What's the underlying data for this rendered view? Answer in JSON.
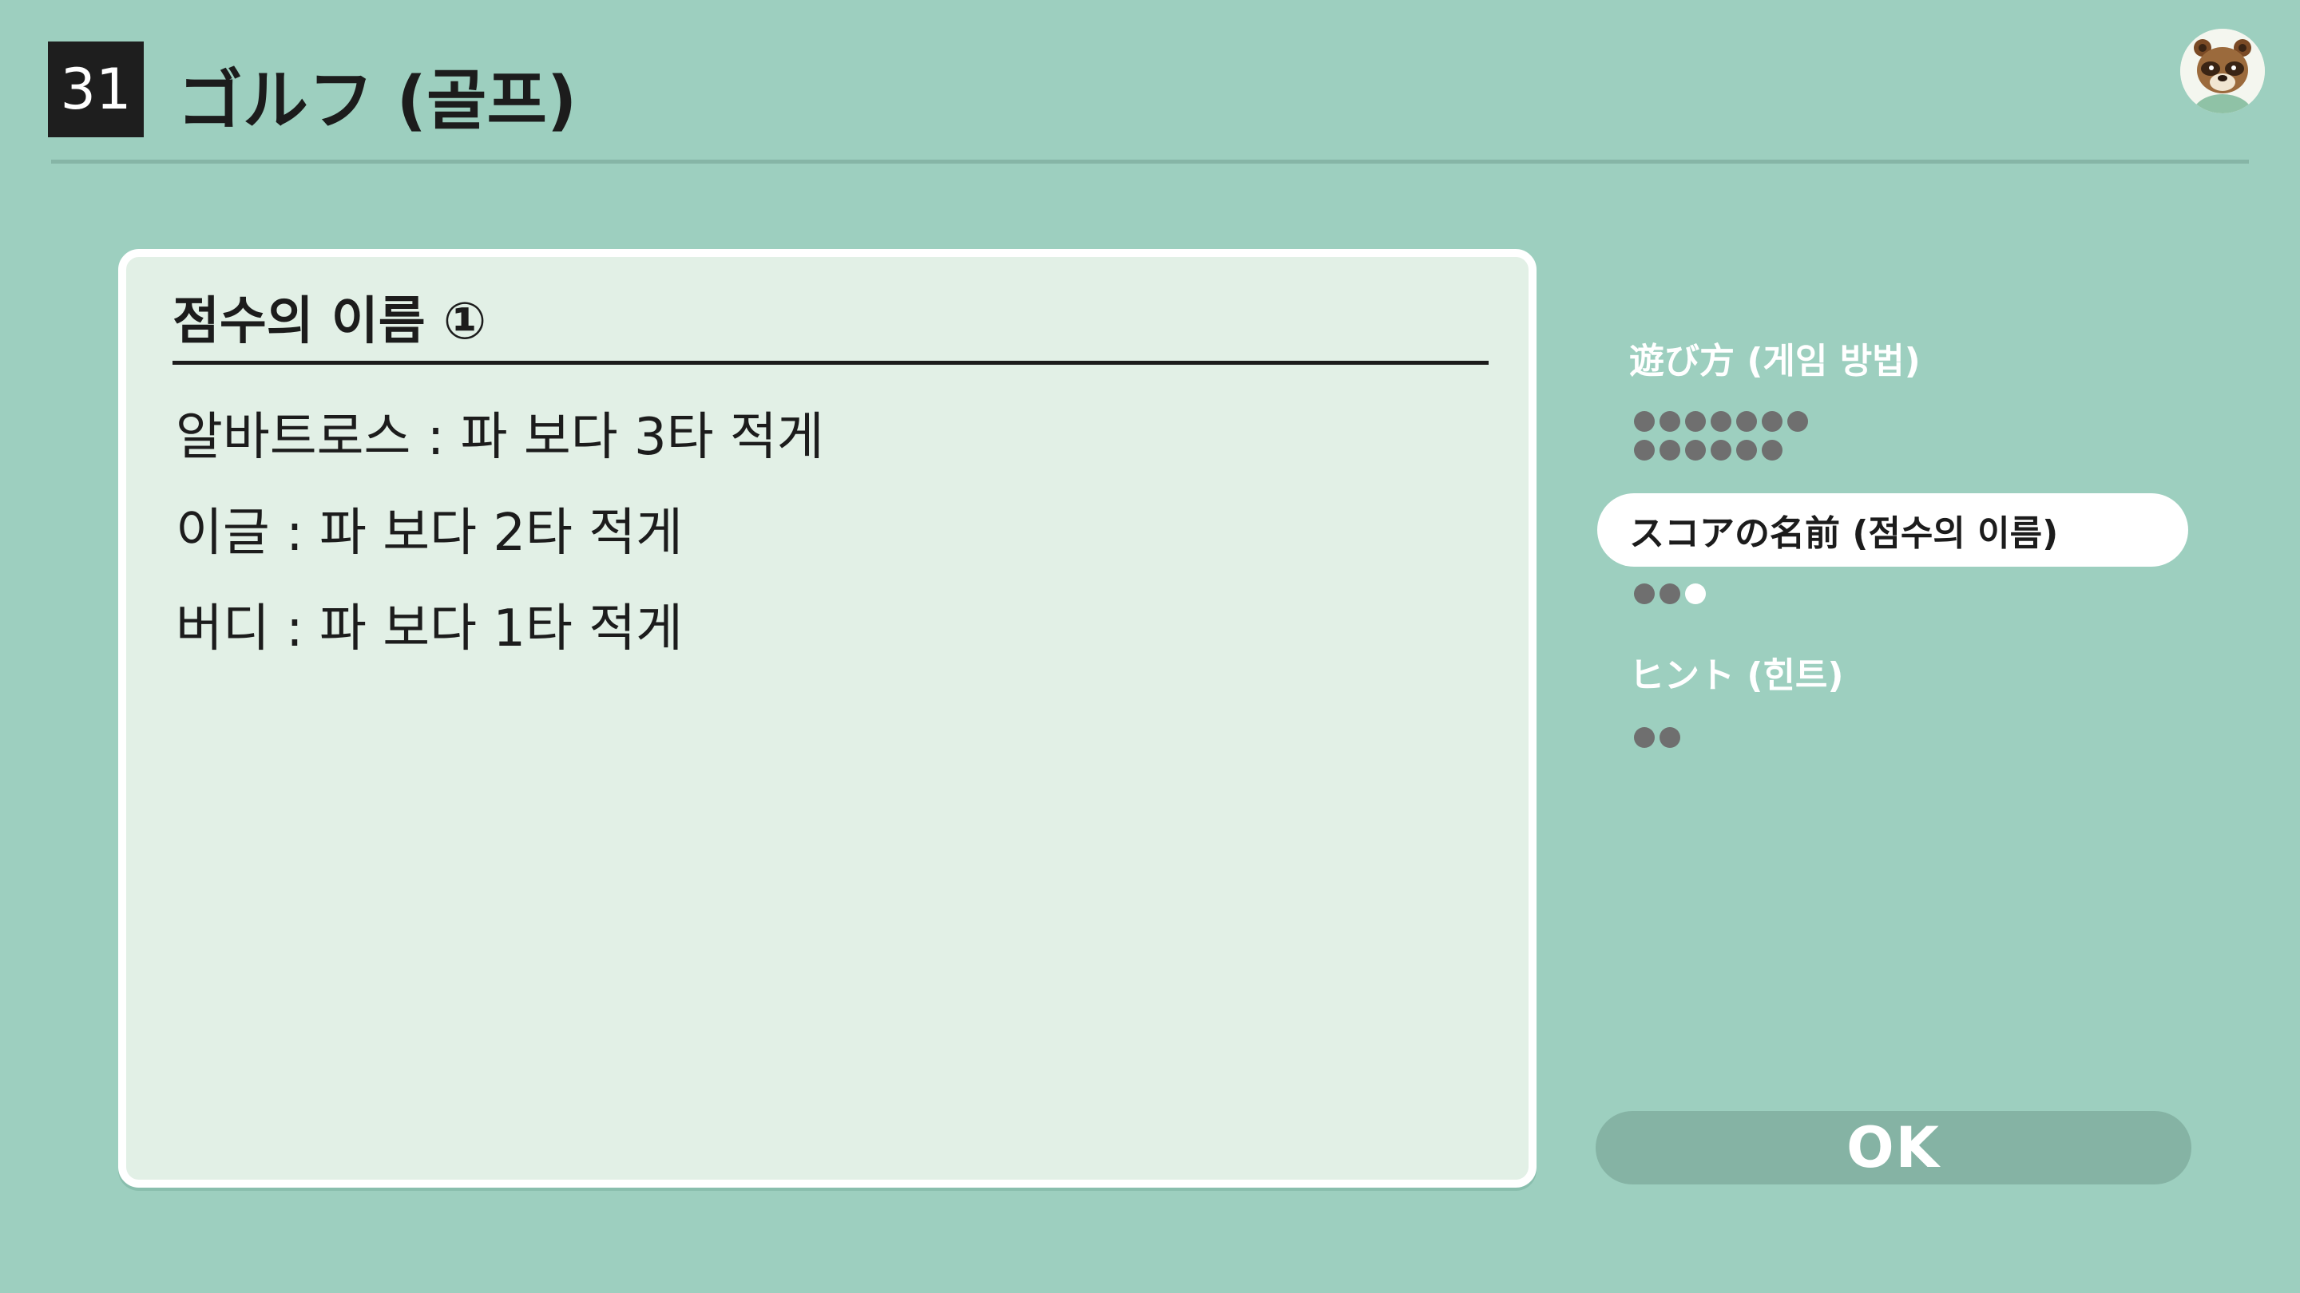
{
  "header": {
    "number": "31",
    "title": "ゴルフ (골프)"
  },
  "panel": {
    "heading": "점수의 이름 ①",
    "lines": [
      "알바트로스 : 파 보다 3타 적게",
      "이글 : 파 보다 2타 적게",
      "버디 : 파 보다 1타 적게"
    ]
  },
  "menu": {
    "items": [
      {
        "label": "遊び方 (게임 방법)",
        "pages": 13,
        "current_page": 0,
        "selected": false
      },
      {
        "label": "スコアの名前 (점수의 이름)",
        "pages": 3,
        "current_page": 2,
        "selected": true
      },
      {
        "label": "ヒント (힌트)",
        "pages": 2,
        "current_page": 0,
        "selected": false
      }
    ]
  },
  "ok_button": {
    "label": "OK"
  },
  "icons": {
    "avatar": "tom-nook-avatar-icon"
  },
  "colors": {
    "background": "#9dcfbf",
    "panel": "#e2f0e6",
    "badge": "#1e1e1e",
    "ok_button": "#85b3a4",
    "page_dot": "#6f6f6f"
  }
}
